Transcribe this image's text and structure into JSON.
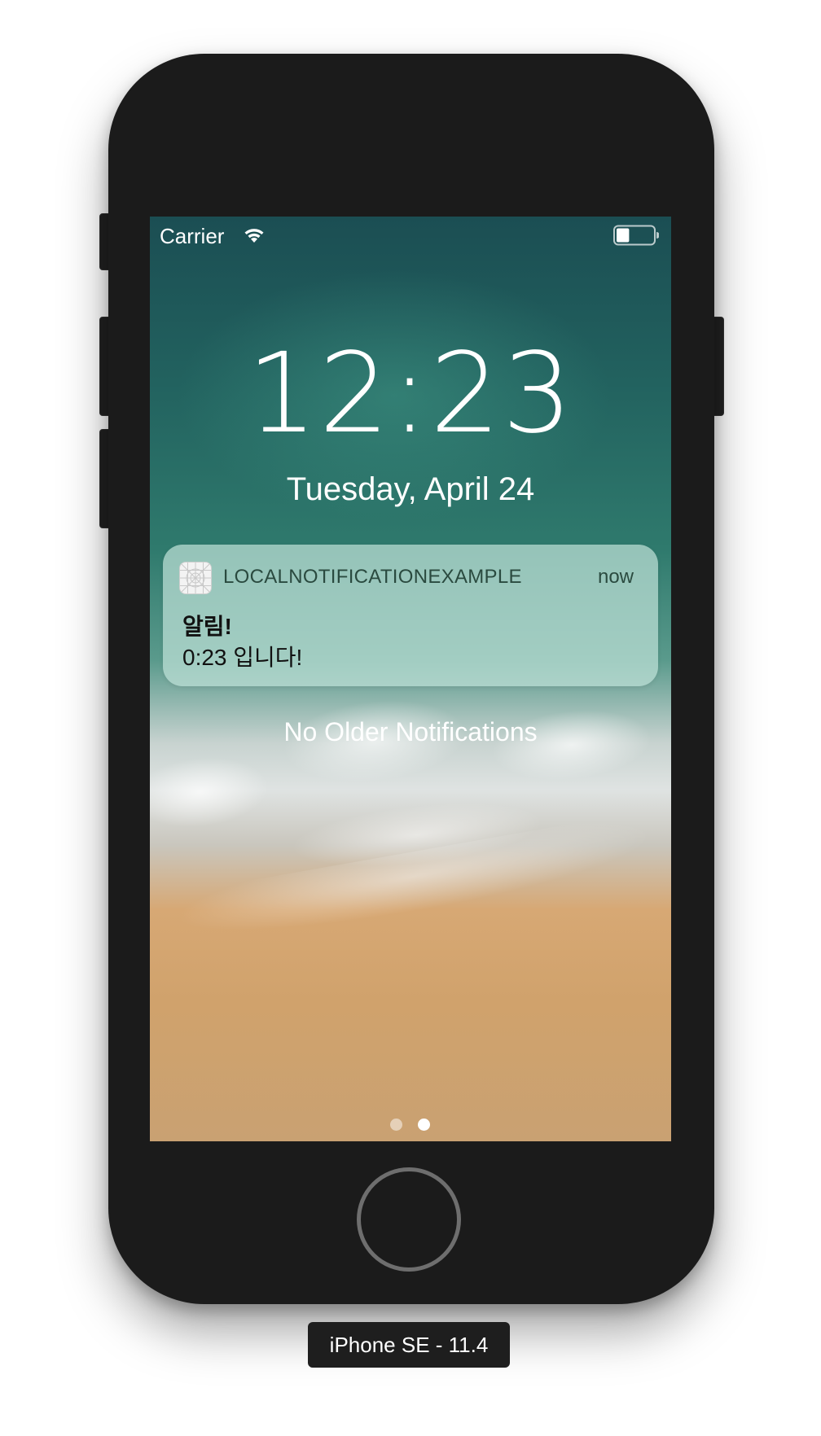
{
  "status_bar": {
    "carrier": "Carrier",
    "wifi_icon": "wifi-icon",
    "battery_icon": "battery-icon",
    "battery_level": 0.35
  },
  "lock_screen": {
    "time": "12:23",
    "date": "Tuesday, April 24"
  },
  "notification": {
    "app_name": "LOCALNOTIFICATIONEXAMPLE",
    "time": "now",
    "title": "알림!",
    "body": "0:23 입니다!",
    "app_icon": "app-grid-icon"
  },
  "no_older_text": "No Older Notifications",
  "page_indicator": {
    "count": 2,
    "active_index": 1
  },
  "device_label": "iPhone SE - 11.4"
}
